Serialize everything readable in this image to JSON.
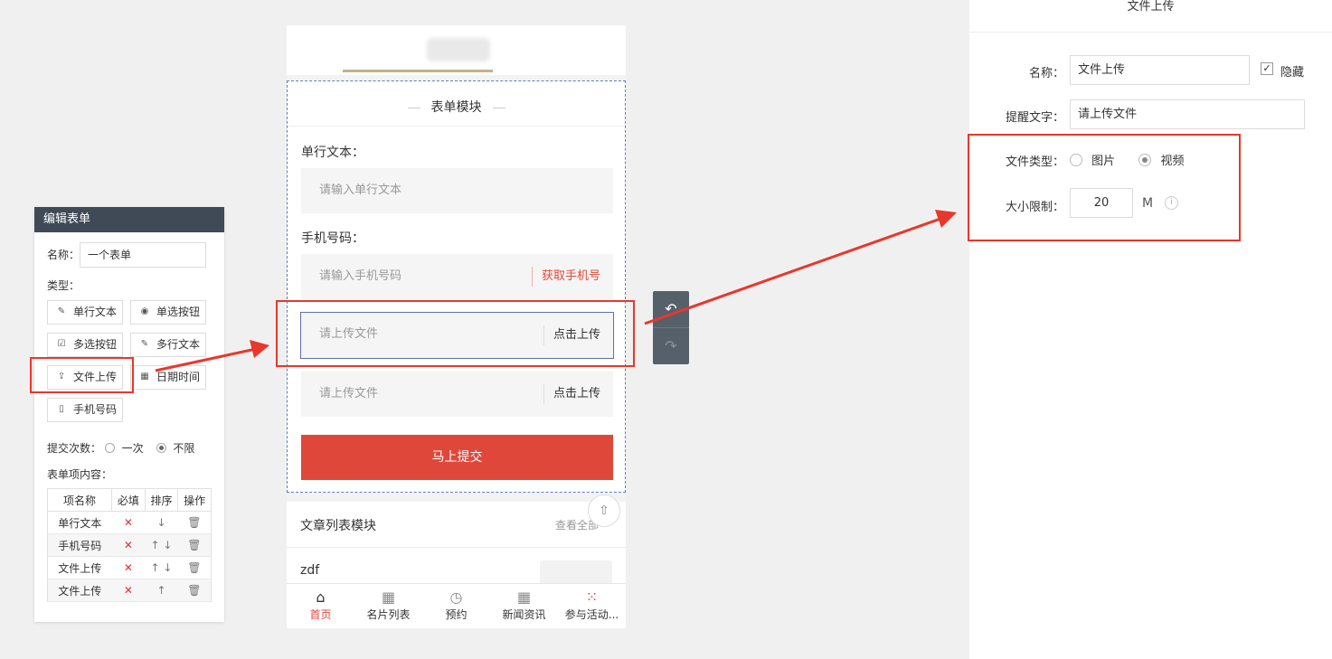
{
  "editor": {
    "title": "编辑表单",
    "name_label": "名称：",
    "name_value": "一个表单",
    "type_label": "类型：",
    "types": [
      {
        "label": "单行文本",
        "icon": "edit-icon",
        "glyph": "✎"
      },
      {
        "label": "单选按钮",
        "icon": "radio-icon",
        "glyph": "◉"
      },
      {
        "label": "多选按钮",
        "icon": "checkbox-icon",
        "glyph": "☑"
      },
      {
        "label": "多行文本",
        "icon": "textarea-icon",
        "glyph": "✎"
      },
      {
        "label": "文件上传",
        "icon": "upload-icon",
        "glyph": "⇪"
      },
      {
        "label": "日期时间",
        "icon": "calendar-icon",
        "glyph": "▦"
      },
      {
        "label": "手机号码",
        "icon": "phone-icon",
        "glyph": "▯"
      }
    ],
    "submit_count_label": "提交次数：",
    "submit_once": "一次",
    "submit_unlimited": "不限",
    "items_label": "表单项内容：",
    "table_headers": [
      "项名称",
      "必填",
      "排序",
      "操作"
    ],
    "rows": [
      {
        "name": "单行文本",
        "required": "✕",
        "sort": "↓",
        "op": "🗑"
      },
      {
        "name": "手机号码",
        "required": "✕",
        "sort": "↑ ↓",
        "op": "🗑"
      },
      {
        "name": "文件上传",
        "required": "✕",
        "sort": "↑ ↓",
        "op": "🗑"
      },
      {
        "name": "文件上传",
        "required": "✕",
        "sort": "↑",
        "op": "🗑"
      }
    ]
  },
  "phone": {
    "module_title": "表单模块",
    "field1_label": "单行文本：",
    "field1_placeholder": "请输入单行文本",
    "field2_label": "手机号码：",
    "field2_placeholder": "请输入手机号码",
    "field2_action": "获取手机号",
    "upload1_placeholder": "请上传文件",
    "upload1_action": "点击上传",
    "upload2_placeholder": "请上传文件",
    "upload2_action": "点击上传",
    "submit_label": "马上提交",
    "article_title": "文章列表模块",
    "article_more": "查看全部",
    "article_item": "zdf",
    "tabs": [
      {
        "label": "首页",
        "icon": "home-icon",
        "glyph": "⌂"
      },
      {
        "label": "名片列表",
        "icon": "grid-icon",
        "glyph": "▦"
      },
      {
        "label": "预约",
        "icon": "clock-icon",
        "glyph": "◷"
      },
      {
        "label": "新闻资讯",
        "icon": "grid-icon",
        "glyph": "▦"
      },
      {
        "label": "参与活动...",
        "icon": "activity-icon",
        "glyph": "⁙"
      }
    ]
  },
  "toolbar": {
    "undo_glyph": "↶",
    "redo_glyph": "↷"
  },
  "settings": {
    "title": "文件上传",
    "name_label": "名称：",
    "name_value": "文件上传",
    "hide_label": "隐藏",
    "hint_label": "提醒文字：",
    "hint_value": "请上传文件",
    "file_type_label": "文件类型：",
    "type_image": "图片",
    "type_video": "视频",
    "size_label": "大小限制：",
    "size_value": "20",
    "size_unit": "M"
  },
  "colors": {
    "accent_red": "#e0473b",
    "annotation_red": "#e8372c",
    "header_dark": "#3f4a56"
  }
}
